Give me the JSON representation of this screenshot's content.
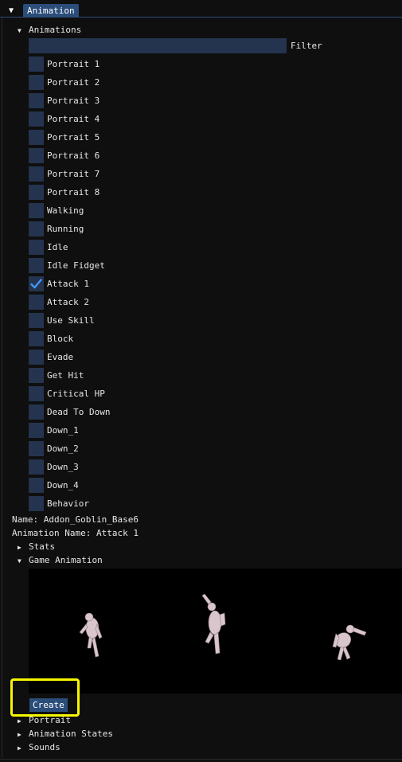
{
  "window": {
    "tab_label": "Animation",
    "collapse_icon": "triangle-down-icon"
  },
  "animations_section": {
    "header_label": "Animations",
    "filter_label": "Filter",
    "filter_value": "",
    "items": [
      {
        "label": "Portrait 1",
        "checked": false
      },
      {
        "label": "Portrait 2",
        "checked": false
      },
      {
        "label": "Portrait 3",
        "checked": false
      },
      {
        "label": "Portrait 4",
        "checked": false
      },
      {
        "label": "Portrait 5",
        "checked": false
      },
      {
        "label": "Portrait 6",
        "checked": false
      },
      {
        "label": "Portrait 7",
        "checked": false
      },
      {
        "label": "Portrait 8",
        "checked": false
      },
      {
        "label": "Walking",
        "checked": false
      },
      {
        "label": "Running",
        "checked": false
      },
      {
        "label": "Idle",
        "checked": false
      },
      {
        "label": "Idle Fidget",
        "checked": false
      },
      {
        "label": "Attack 1",
        "checked": true
      },
      {
        "label": "Attack 2",
        "checked": false
      },
      {
        "label": "Use Skill",
        "checked": false
      },
      {
        "label": "Block",
        "checked": false
      },
      {
        "label": "Evade",
        "checked": false
      },
      {
        "label": "Get Hit",
        "checked": false
      },
      {
        "label": "Critical HP",
        "checked": false
      },
      {
        "label": "Dead To Down",
        "checked": false
      },
      {
        "label": "Down_1",
        "checked": false
      },
      {
        "label": "Down_2",
        "checked": false
      },
      {
        "label": "Down_3",
        "checked": false
      },
      {
        "label": "Down_4",
        "checked": false
      },
      {
        "label": "Behavior",
        "checked": false
      }
    ]
  },
  "info": {
    "name_line": "Name: Addon_Goblin_Base6",
    "animation_name_line": "Animation Name: Attack 1"
  },
  "sections": {
    "stats": "Stats",
    "game_animation": "Game Animation",
    "portrait": "Portrait",
    "animation_states": "Animation States",
    "sounds": "Sounds"
  },
  "create_button_label": "Create",
  "colors": {
    "background": "#0f0f0f",
    "accent": "#2b4d7a",
    "checkbox_bg": "#24344f",
    "checkmark": "#4296fa",
    "highlight": "#f6f600"
  }
}
